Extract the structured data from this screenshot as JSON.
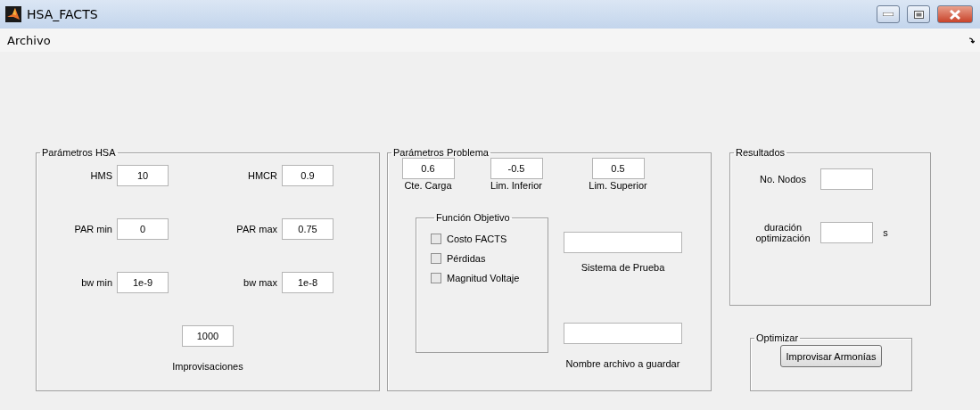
{
  "window": {
    "title": "HSA_FACTS"
  },
  "menu": [
    "Archivo"
  ],
  "hsa_panel": {
    "title": "Parámetros HSA",
    "fields": [
      {
        "label": "HMS",
        "value": "10"
      },
      {
        "label": "HMCR",
        "value": "0.9"
      },
      {
        "label": "PAR min",
        "value": "0"
      },
      {
        "label": "PAR max",
        "value": "0.75"
      },
      {
        "label": "bw min",
        "value": "1e-9"
      },
      {
        "label": "bw max",
        "value": "1e-8"
      }
    ],
    "improvisaciones": {
      "value": "1000",
      "label": "Improvisaciones"
    }
  },
  "problem_panel": {
    "title": "Parámetros Problema",
    "fields": [
      {
        "value": "0.6",
        "label": "Cte. Carga"
      },
      {
        "value": "-0.5",
        "label": "Lim. Inferior"
      },
      {
        "value": "0.5",
        "label": "Lim. Superior"
      }
    ],
    "objective": {
      "title": "Función Objetivo",
      "options": [
        {
          "label": "Costo FACTS",
          "checked": false
        },
        {
          "label": "Pérdidas",
          "checked": false
        },
        {
          "label": "Magnitud Voltaje",
          "checked": false
        }
      ]
    },
    "text_fields": [
      {
        "label": "Sistema de Prueba"
      },
      {
        "label": "Nombre archivo a guardar"
      }
    ]
  },
  "results_panel": {
    "title": "Resultados",
    "fields": [
      {
        "label": "No. Nodos"
      },
      {
        "label": "duración optimización",
        "unit": "s"
      }
    ]
  },
  "optimize_panel": {
    "title": "Optimizar",
    "button": "Improvisar Armonías"
  }
}
